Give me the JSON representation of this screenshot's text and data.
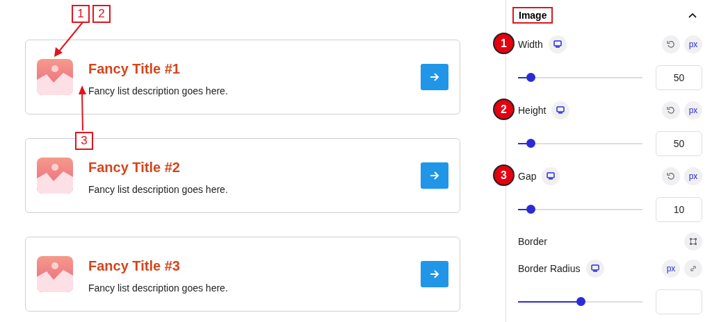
{
  "list_items": [
    {
      "title": "Fancy Title #1",
      "description": "Fancy list description goes here."
    },
    {
      "title": "Fancy Title #2",
      "description": "Fancy list description goes here."
    },
    {
      "title": "Fancy Title #3",
      "description": "Fancy list description goes here."
    }
  ],
  "callouts": [
    {
      "label": "1"
    },
    {
      "label": "2"
    },
    {
      "label": "3"
    }
  ],
  "panel": {
    "title": "Image",
    "expanded": true,
    "controls": [
      {
        "kind": "slider",
        "label": "Width",
        "marker": "1",
        "responsive": true,
        "reset": true,
        "unit": "px",
        "link": false,
        "level": 0.1,
        "value": "50"
      },
      {
        "kind": "slider",
        "label": "Height",
        "marker": "2",
        "responsive": true,
        "reset": true,
        "unit": "px",
        "link": false,
        "level": 0.1,
        "value": "50"
      },
      {
        "kind": "slider",
        "label": "Gap",
        "marker": "3",
        "responsive": true,
        "reset": true,
        "unit": "px",
        "link": false,
        "level": 0.1,
        "value": "10"
      },
      {
        "kind": "popover",
        "label": "Border"
      },
      {
        "kind": "slider",
        "label": "Border Radius",
        "responsive": true,
        "reset": false,
        "unit": "px",
        "link": true,
        "level": 0.5
      }
    ]
  }
}
